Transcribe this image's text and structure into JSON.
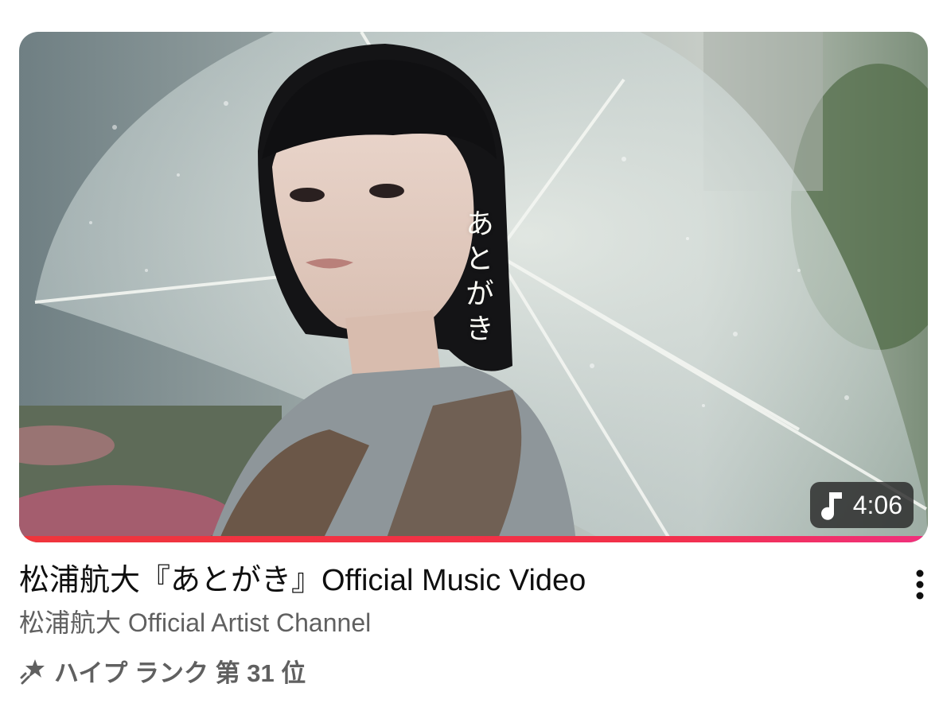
{
  "video": {
    "vertical_title": "あとがき",
    "duration": "4:06",
    "duration_icon": "music-note-icon",
    "watch_progress": 1.0,
    "progress_color": "#f0353c",
    "title": "松浦航大『あとがき』Official Music Video",
    "channel": "松浦航大 Official Artist Channel",
    "hype_icon": "hype-rocket-icon",
    "hype_rank": "ハイプ ランク 第 31 位",
    "menu_icon": "more-vert-icon"
  }
}
